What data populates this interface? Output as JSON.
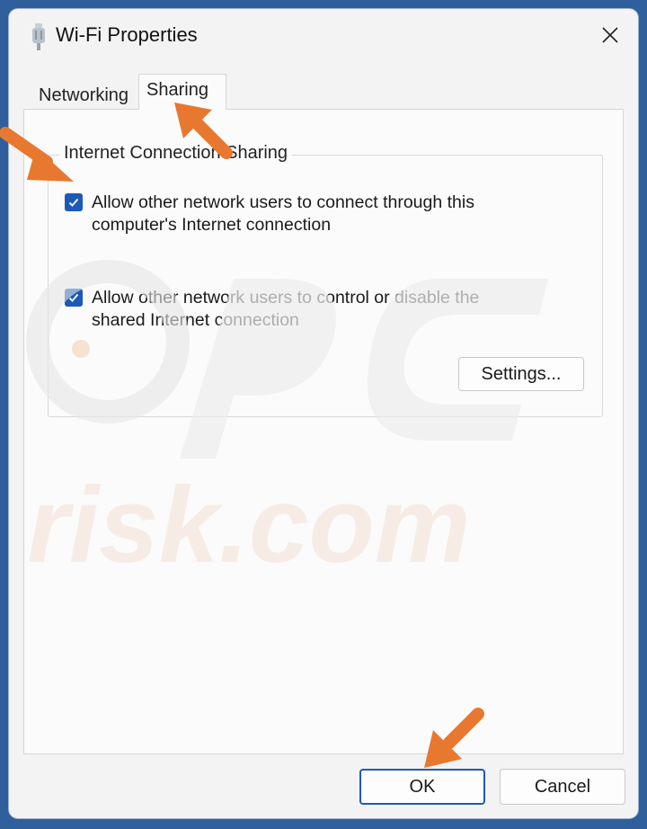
{
  "window": {
    "title": "Wi-Fi Properties",
    "icon": "wifi-adapter-icon",
    "close_icon": "close-icon"
  },
  "tabs": [
    {
      "label": "Networking",
      "selected": false
    },
    {
      "label": "Sharing",
      "selected": true
    }
  ],
  "sharing": {
    "group_title": "Internet Connection Sharing",
    "options": [
      {
        "label_line1": "Allow other network users to connect through this",
        "label_line2": "computer's Internet connection",
        "checked": true
      },
      {
        "label_line1": "Allow other network users to control or disable the",
        "label_line2": "shared Internet connection",
        "checked": true
      }
    ],
    "settings_button": "Settings..."
  },
  "footer": {
    "ok_label": "OK",
    "cancel_label": "Cancel"
  },
  "colors": {
    "accent": "#1d5ab8",
    "annotation_arrow": "#e8782f",
    "background": "#2f5f9c"
  }
}
